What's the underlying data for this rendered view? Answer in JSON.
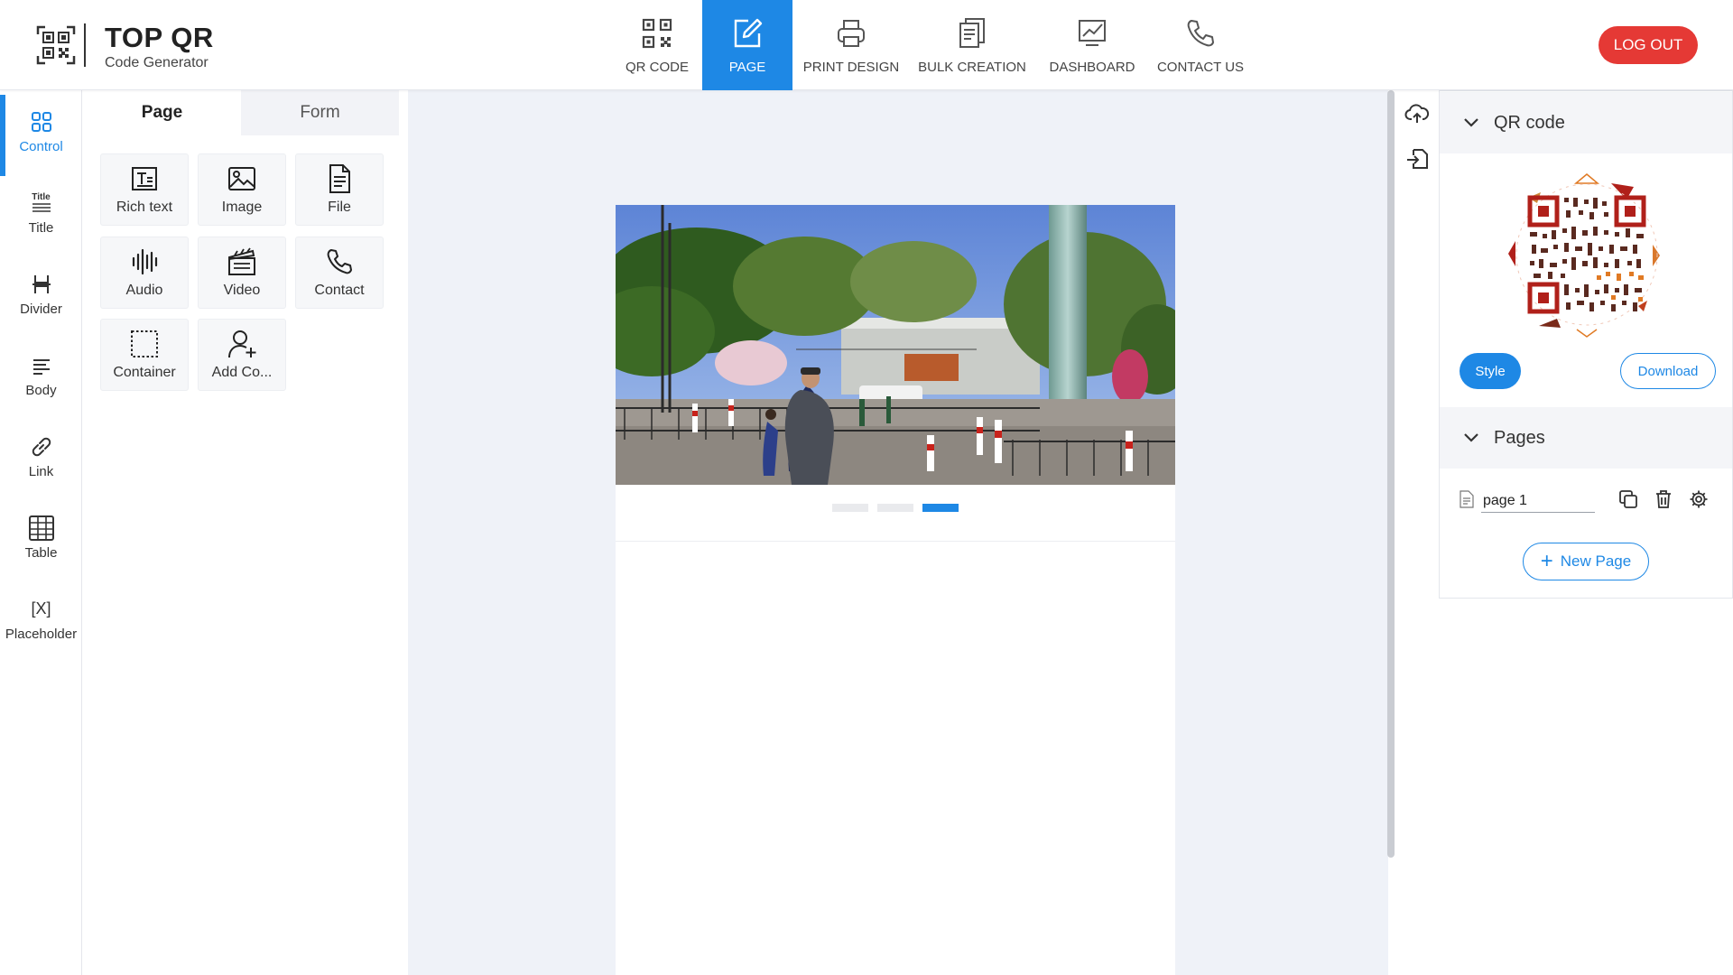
{
  "brand": {
    "title": "TOP QR",
    "subtitle": "Code Generator"
  },
  "nav": {
    "items": [
      {
        "label": "QR CODE",
        "icon": "qr-code-icon",
        "active": false
      },
      {
        "label": "PAGE",
        "icon": "edit-page-icon",
        "active": true
      },
      {
        "label": "PRINT DESIGN",
        "icon": "printer-icon",
        "active": false
      },
      {
        "label": "BULK CREATION",
        "icon": "documents-icon",
        "active": false
      },
      {
        "label": "DASHBOARD",
        "icon": "chart-icon",
        "active": false
      },
      {
        "label": "CONTACT US",
        "icon": "phone-icon",
        "active": false
      }
    ],
    "logout": "LOG OUT"
  },
  "sidebar": {
    "items": [
      {
        "label": "Control",
        "icon": "grid-icon",
        "active": true
      },
      {
        "label": "Title",
        "icon": "title-icon",
        "icon_text": "Title"
      },
      {
        "label": "Divider",
        "icon": "divider-icon"
      },
      {
        "label": "Body",
        "icon": "body-text-icon"
      },
      {
        "label": "Link",
        "icon": "link-icon"
      },
      {
        "label": "Table",
        "icon": "table-icon"
      },
      {
        "label": "Placeholder",
        "icon": "placeholder-icon",
        "icon_text": "[X]"
      }
    ]
  },
  "panel": {
    "tabs": [
      {
        "label": "Page",
        "active": true
      },
      {
        "label": "Form",
        "active": false
      }
    ],
    "tiles": [
      {
        "label": "Rich text",
        "icon": "rich-text-icon"
      },
      {
        "label": "Image",
        "icon": "image-icon"
      },
      {
        "label": "File",
        "icon": "file-icon"
      },
      {
        "label": "Audio",
        "icon": "audio-icon"
      },
      {
        "label": "Video",
        "icon": "video-icon"
      },
      {
        "label": "Contact",
        "icon": "phone-icon"
      },
      {
        "label": "Container",
        "icon": "container-icon"
      },
      {
        "label": "Add Co...",
        "icon": "add-contact-icon"
      }
    ]
  },
  "canvas": {
    "slides": 3,
    "active_slide": 3
  },
  "right": {
    "qr_section": "QR code",
    "style_btn": "Style",
    "download_btn": "Download",
    "pages_section": "Pages",
    "pages": [
      {
        "name": "page 1"
      }
    ],
    "new_page": "New Page"
  },
  "colors": {
    "accent": "#1e88e5",
    "logout": "#e53935",
    "canvas_bg": "#eff2f8",
    "qr_dark": "#b0201a",
    "qr_warm": "#e07a24"
  }
}
